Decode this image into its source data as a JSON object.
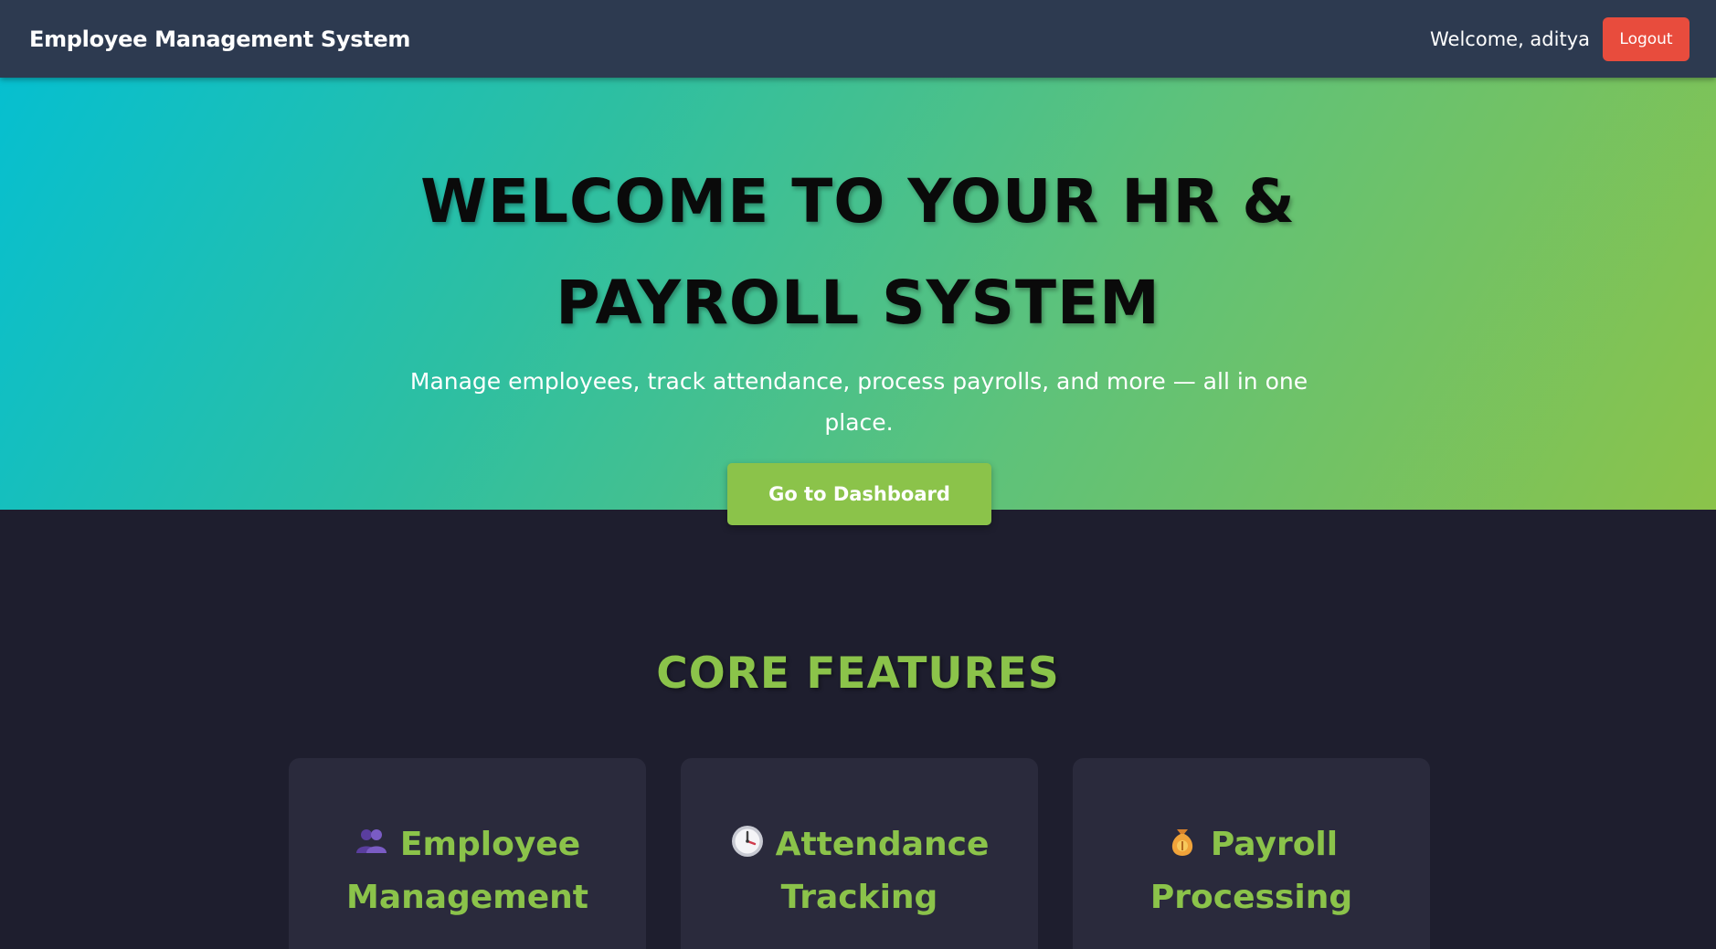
{
  "navbar": {
    "brand": "Employee Management System",
    "welcome": "Welcome, aditya",
    "logout_label": "Logout"
  },
  "hero": {
    "title_line1": "WELCOME TO YOUR HR &",
    "title_line2": "PAYROLL SYSTEM",
    "subtitle_line1": "Manage employees, track attendance, process payrolls, and more — all in one",
    "subtitle_line2": "place.",
    "cta_label": "Go to Dashboard"
  },
  "features": {
    "heading": "CORE FEATURES",
    "cards": [
      {
        "icon": "people-icon",
        "title_line1": "Employee",
        "title_line2": "Management"
      },
      {
        "icon": "clock-icon",
        "title_line1": "Attendance",
        "title_line2": "Tracking"
      },
      {
        "icon": "money-bag-icon",
        "title_line1": "Payroll",
        "title_line2": "Processing"
      }
    ]
  },
  "colors": {
    "navbar_bg": "#2d3a50",
    "logout_bg": "#e84c3d",
    "accent_green": "#8bc34a",
    "hero_gradient_start": "#06bfd0",
    "hero_gradient_end": "#8bc34a",
    "page_bg": "#1e1e2e",
    "card_bg": "#2a2a3c"
  }
}
